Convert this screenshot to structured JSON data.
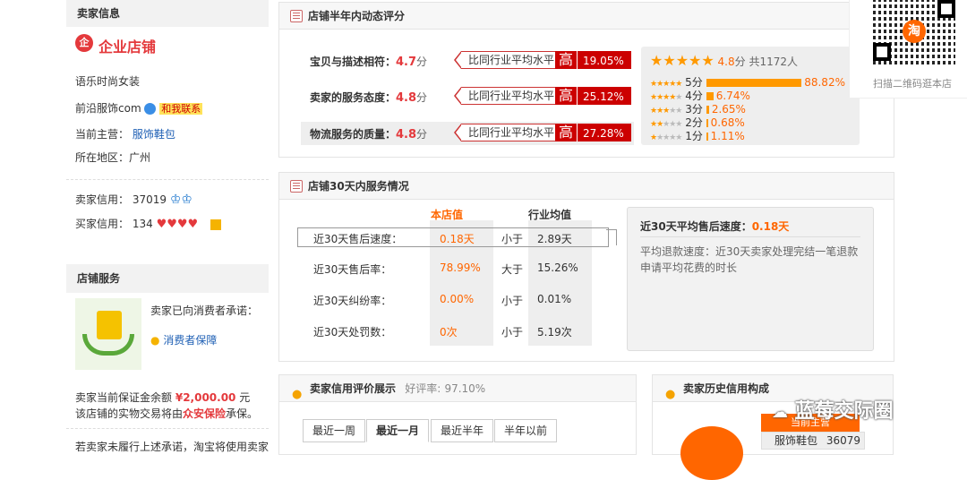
{
  "seller_info": {
    "title": "卖家信息",
    "company_type": "企业店铺",
    "shop_name": "语乐时尚女装",
    "shop_url": "前沿服饰com",
    "contact": "和我联系",
    "main_business_label": "当前主营：",
    "main_business": "服饰鞋包",
    "region_label": "所在地区：",
    "region": "广州",
    "seller_credit_label": "卖家信用：",
    "seller_credit_value": "37019",
    "buyer_credit_label": "买家信用：",
    "buyer_credit_value": "134"
  },
  "shop_service": {
    "title": "店铺服务",
    "promise_text": "卖家已向消费者承诺：",
    "guarantee_link": "消费者保障",
    "deposit_text_1": "卖家当前保证金余额",
    "deposit_amount": "¥2,000.00",
    "deposit_unit": "元",
    "deposit_text_2": "该店铺的实物交易将由",
    "insurance": "众安保险",
    "deposit_text_3": "承保。",
    "footer_text": "若卖家未履行上述承诺，淘宝将使用卖家"
  },
  "dynamic_rating": {
    "title": "店铺半年内动态评分",
    "rows": [
      {
        "label": "宝贝与描述相符：",
        "score": "4.7",
        "unit": "分",
        "compare": "比同行业平均水平",
        "level": "高",
        "percent": "19.05%"
      },
      {
        "label": "卖家的服务态度：",
        "score": "4.8",
        "unit": "分",
        "compare": "比同行业平均水平",
        "level": "高",
        "percent": "25.12%"
      },
      {
        "label": "物流服务的质量：",
        "score": "4.8",
        "unit": "分",
        "compare": "比同行业平均水平",
        "level": "高",
        "percent": "27.28%"
      }
    ],
    "summary_score": "4.8",
    "summary_unit": "分",
    "summary_count": "共1172人",
    "distribution": [
      {
        "stars": "5分",
        "percent": "88.82%",
        "value": 88.82
      },
      {
        "stars": "4分",
        "percent": "6.74%",
        "value": 6.74
      },
      {
        "stars": "3分",
        "percent": "2.65%",
        "value": 2.65
      },
      {
        "stars": "2分",
        "percent": "0.68%",
        "value": 0.68
      },
      {
        "stars": "1分",
        "percent": "1.11%",
        "value": 1.11
      }
    ]
  },
  "service_30": {
    "title": "店铺30天内服务情况",
    "col_shop": "本店值",
    "col_industry": "行业均值",
    "rows": [
      {
        "label": "近30天售后速度：",
        "shop": "0.18天",
        "cmp": "小于",
        "industry": "2.89天"
      },
      {
        "label": "近30天售后率：",
        "shop": "78.99%",
        "cmp": "大于",
        "industry": "15.26%"
      },
      {
        "label": "近30天纠纷率：",
        "shop": "0.00%",
        "cmp": "小于",
        "industry": "0.01%"
      },
      {
        "label": "近30天处罚数：",
        "shop": "0次",
        "cmp": "小于",
        "industry": "5.19次"
      }
    ],
    "detail_title": "近30天平均售后速度：",
    "detail_value": "0.18天",
    "detail_desc": "平均退款速度：近30天卖家处理完结一笔退款申请平均花费的时长"
  },
  "credit_display": {
    "title": "卖家信用评价展示",
    "rate_label": "好评率:",
    "rate": "97.10%",
    "tabs": [
      "最近一周",
      "最近一月",
      "最近半年",
      "半年以前"
    ]
  },
  "credit_history": {
    "title": "卖家历史信用构成",
    "current_label": "当前主营",
    "category": "服饰鞋包",
    "value": "36079"
  },
  "qr": {
    "caption": "扫描二维码逛本店",
    "logo": "淘"
  },
  "watermark": "蓝莓交际圈"
}
